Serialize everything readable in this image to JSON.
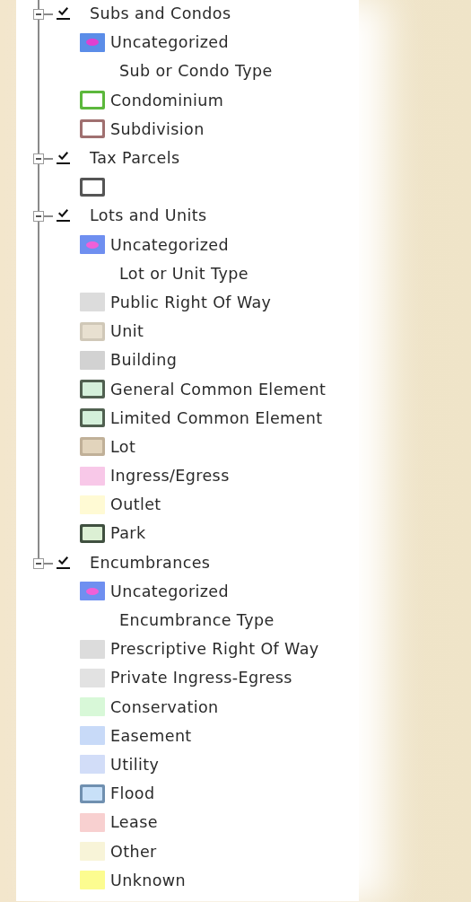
{
  "layers": [
    {
      "name": "Subs and Condos",
      "checked": true,
      "expanded": true,
      "legend": [
        {
          "kind": "dot",
          "label": "Uncategorized",
          "fill": {
            "color": "#5b8de8"
          },
          "dot": {
            "color": "#e040d0"
          }
        },
        {
          "kind": "heading",
          "label": "Sub or Condo Type"
        },
        {
          "kind": "swatch",
          "label": "Condominium",
          "fill": {
            "color": "#ffffff"
          },
          "border": {
            "color": "#5cb83c"
          }
        },
        {
          "kind": "swatch",
          "label": "Subdivision",
          "fill": {
            "color": "#ffffff"
          },
          "border": {
            "color": "#a07070"
          }
        }
      ]
    },
    {
      "name": "Tax Parcels",
      "checked": true,
      "expanded": true,
      "legend": [
        {
          "kind": "swatch",
          "fill": {
            "color": "#ffffff"
          },
          "border": {
            "color": "#555555"
          }
        }
      ]
    },
    {
      "name": "Lots and Units",
      "checked": true,
      "expanded": true,
      "legend": [
        {
          "kind": "dot",
          "label": "Uncategorized",
          "fill": {
            "color": "#6f8ff0"
          },
          "dot": {
            "color": "#f060d8"
          }
        },
        {
          "kind": "heading",
          "label": "Lot or Unit Type"
        },
        {
          "kind": "swatch",
          "label": "Public Right Of Way",
          "fill": {
            "color": "#dcdcdc"
          }
        },
        {
          "kind": "swatch",
          "label": "Unit",
          "fill": {
            "color": "#e8e0d0"
          },
          "border": {
            "color": "#d0c8b8"
          }
        },
        {
          "kind": "swatch",
          "label": "Building",
          "fill": {
            "color": "#d2d2d2"
          }
        },
        {
          "kind": "swatch",
          "label": "General Common Element",
          "fill": {
            "color": "#d4f0da"
          },
          "border": {
            "color": "#506050"
          }
        },
        {
          "kind": "swatch",
          "label": "Limited Common Element",
          "fill": {
            "color": "#d4f0da"
          },
          "border": {
            "color": "#506050"
          }
        },
        {
          "kind": "swatch",
          "label": "Lot",
          "fill": {
            "color": "#e2d4bc"
          },
          "border": {
            "color": "#c0b098"
          }
        },
        {
          "kind": "swatch",
          "label": "Ingress/Egress",
          "fill": {
            "color": "#f8c8e8"
          }
        },
        {
          "kind": "swatch",
          "label": "Outlet",
          "fill": {
            "color": "#fffad4"
          }
        },
        {
          "kind": "swatch",
          "label": "Park",
          "fill": {
            "color": "#dcf0d4"
          },
          "border": {
            "color": "#405040"
          }
        }
      ]
    },
    {
      "name": "Encumbrances",
      "checked": true,
      "expanded": true,
      "legend": [
        {
          "kind": "dot",
          "label": "Uncategorized",
          "fill": {
            "color": "#6f8ff0"
          },
          "dot": {
            "color": "#f060d8"
          }
        },
        {
          "kind": "heading",
          "label": "Encumbrance Type"
        },
        {
          "kind": "swatch",
          "label": "Prescriptive Right Of Way",
          "fill": {
            "color": "#dcdcdc"
          }
        },
        {
          "kind": "swatch",
          "label": "Private Ingress-Egress",
          "fill": {
            "color": "#e2e2e2"
          }
        },
        {
          "kind": "swatch",
          "label": "Conservation",
          "fill": {
            "color": "#d8f8d8"
          }
        },
        {
          "kind": "swatch",
          "label": "Easement",
          "fill": {
            "color": "#c8daf8"
          }
        },
        {
          "kind": "swatch",
          "label": "Utility",
          "fill": {
            "color": "#d2ddf8"
          }
        },
        {
          "kind": "swatch",
          "label": "Flood",
          "fill": {
            "color": "#c8e0f8"
          },
          "border": {
            "color": "#7090b0"
          }
        },
        {
          "kind": "swatch",
          "label": "Lease",
          "fill": {
            "color": "#f8d0d0"
          }
        },
        {
          "kind": "swatch",
          "label": "Other",
          "fill": {
            "color": "#f8f4d8"
          }
        },
        {
          "kind": "swatch",
          "label": "Unknown",
          "fill": {
            "color": "#fcfc90"
          }
        }
      ]
    }
  ]
}
